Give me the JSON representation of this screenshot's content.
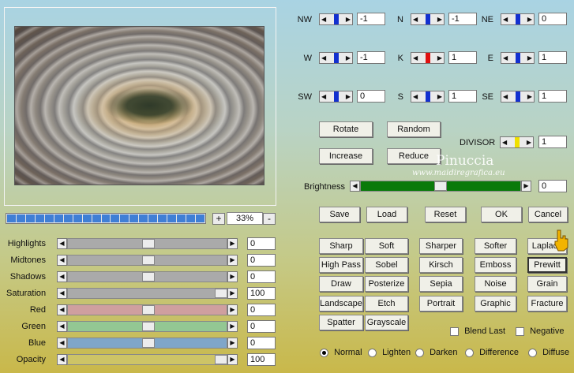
{
  "progress": {
    "segments": 21,
    "filled_fraction": 1.0
  },
  "zoom": {
    "minus": "-",
    "plus": "+",
    "value": "33%"
  },
  "sliders": [
    {
      "label": "Highlights",
      "value": "0",
      "track_color": "#aaaaaa"
    },
    {
      "label": "Midtones",
      "value": "0",
      "track_color": "#aaaaaa"
    },
    {
      "label": "Shadows",
      "value": "0",
      "track_color": "#aaaaaa"
    },
    {
      "label": "Saturation",
      "value": "100",
      "track_color": "#aaaaaa"
    },
    {
      "label": "Red",
      "value": "0",
      "track_color": "#cf9f9f"
    },
    {
      "label": "Green",
      "value": "0",
      "track_color": "#93c793"
    },
    {
      "label": "Blue",
      "value": "0",
      "track_color": "#7fa6c9"
    },
    {
      "label": "Opacity",
      "value": "100",
      "track_color": "#cdc466"
    }
  ],
  "directions": {
    "nw": {
      "label": "NW",
      "value": "-1"
    },
    "n": {
      "label": "N",
      "value": "-1"
    },
    "ne": {
      "label": "NE",
      "value": "0"
    },
    "w": {
      "label": "W",
      "value": "-1"
    },
    "k": {
      "label": "K",
      "value": "1"
    },
    "e": {
      "label": "E",
      "value": "1"
    },
    "sw": {
      "label": "SW",
      "value": "0"
    },
    "s": {
      "label": "S",
      "value": "1"
    },
    "se": {
      "label": "SE",
      "value": "1"
    }
  },
  "actions": {
    "rotate": "Rotate",
    "random": "Random",
    "increase": "Increase",
    "reduce": "Reduce"
  },
  "divisor": {
    "label": "DIVISOR",
    "value": "1"
  },
  "watermark": {
    "line1": "Pinuccia",
    "line2": "www.maidiregrafica.eu"
  },
  "brightness": {
    "label": "Brightness",
    "value": "0",
    "track_color": "#0a7a0a"
  },
  "main_buttons": {
    "save": "Save",
    "load": "Load",
    "reset": "Reset",
    "ok": "OK",
    "cancel": "Cancel"
  },
  "presets": [
    [
      "Sharp",
      "Soft",
      "Sharper",
      "Softer",
      "Laplace"
    ],
    [
      "High Pass",
      "Sobel",
      "Kirsch",
      "Emboss",
      "Prewitt"
    ],
    [
      "Draw",
      "Posterize",
      "Sepia",
      "Noise",
      "Grain"
    ],
    [
      "Landscape",
      "Etch",
      "Portrait",
      "Graphic",
      "Fracture"
    ],
    [
      "Spatter",
      "Grayscale"
    ]
  ],
  "checkboxes": {
    "blend_last": "Blend Last",
    "negative": "Negative"
  },
  "blend_modes": [
    "Normal",
    "Lighten",
    "Darken",
    "Difference",
    "Diffuse"
  ],
  "selected_blend_mode": "Normal",
  "colors": {
    "spin_blue": "#1230d0",
    "spin_red": "#e01010",
    "divisor_yellow": "#f0e000",
    "progress_blue": "#3f7fd6"
  }
}
